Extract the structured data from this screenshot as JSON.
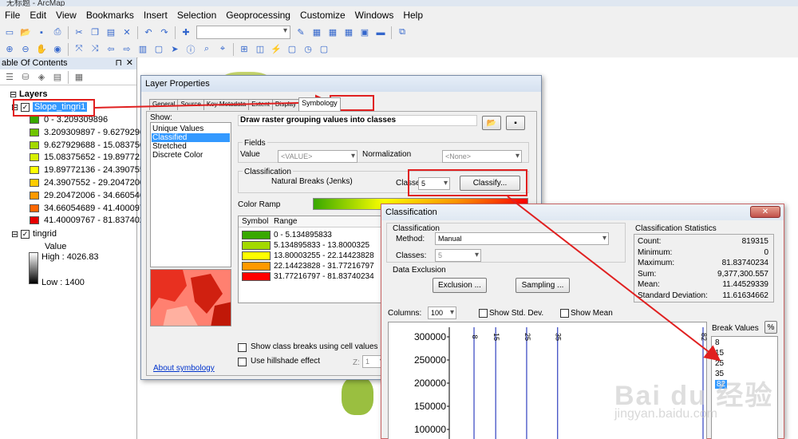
{
  "window": {
    "title": "无标题 - ArcMap"
  },
  "menu": [
    "File",
    "Edit",
    "View",
    "Bookmarks",
    "Insert",
    "Selection",
    "Geoprocessing",
    "Customize",
    "Windows",
    "Help"
  ],
  "toc": {
    "title": "able Of Contents",
    "layers_label": "Layers",
    "layer1": "Slope_tingri1",
    "classes": [
      {
        "label": "0 - 3.209309896",
        "color": "#38a800"
      },
      {
        "label": "3.209309897 - 9.62792968",
        "color": "#6fc400"
      },
      {
        "label": "9.627929688 - 15.0837565",
        "color": "#a3d900"
      },
      {
        "label": "15.08375652 - 19.8977213",
        "color": "#d6f000"
      },
      {
        "label": "19.89772136 - 24.3907552",
        "color": "#ffff00"
      },
      {
        "label": "24.3907552 - 29.2047200",
        "color": "#ffcc00"
      },
      {
        "label": "29.20472006 - 34.6605468",
        "color": "#ff9900"
      },
      {
        "label": "34.66054689 - 41.4000976",
        "color": "#ff6600"
      },
      {
        "label": "41.40009767 - 81.8374023",
        "color": "#e60000"
      }
    ],
    "layer2": "tingrid",
    "value_label": "Value",
    "high": "High : 4026.83",
    "low": "Low : 1400"
  },
  "layer_props": {
    "title": "Layer Properties",
    "tabs": [
      "General",
      "Source",
      "Key Metadata",
      "Extent",
      "Display",
      "Symbology"
    ],
    "show_label": "Show:",
    "show_items": [
      "Unique Values",
      "Classified",
      "Stretched",
      "Discrete Color"
    ],
    "heading": "Draw raster grouping values into classes",
    "fields_label": "Fields",
    "value_label": "Value",
    "value_field": "<VALUE>",
    "normalization_label": "Normalization",
    "normalization_field": "<None>",
    "classification_label": "Classification",
    "method": "Natural Breaks (Jenks)",
    "classes_label": "Classes",
    "classes_value": "5",
    "classify_button": "Classify...",
    "color_ramp_label": "Color Ramp",
    "symbol_header": "Symbol",
    "range_header": "Range",
    "rows": [
      {
        "range": "0 - 5.134895833",
        "color": "#38a800"
      },
      {
        "range": "5.134895833 - 13.8000325",
        "color": "#a3d900"
      },
      {
        "range": "13.80003255 - 22.14423828",
        "color": "#ffff00"
      },
      {
        "range": "22.14423828 - 31.77216797",
        "color": "#ff9900"
      },
      {
        "range": "31.77216797 - 81.83740234",
        "color": "#ff0000"
      }
    ],
    "show_breaks": "Show class breaks using cell values",
    "hillshade": "Use hillshade effect",
    "z_label": "Z:",
    "z_value": "1",
    "about": "About symbology"
  },
  "classification": {
    "title": "Classification",
    "group_label": "Classification",
    "method_label": "Method:",
    "method_value": "Manual",
    "classes_label": "Classes:",
    "classes_value": "5",
    "exclusion_label": "Data Exclusion",
    "exclusion_button": "Exclusion ...",
    "sampling_button": "Sampling ...",
    "stats_title": "Classification Statistics",
    "stats": [
      {
        "k": "Count:",
        "v": "819315"
      },
      {
        "k": "Minimum:",
        "v": "0"
      },
      {
        "k": "Maximum:",
        "v": "81.83740234"
      },
      {
        "k": "Sum:",
        "v": "9,377,300.557"
      },
      {
        "k": "Mean:",
        "v": "11.44529339"
      },
      {
        "k": "Standard Deviation:",
        "v": "11.61634662"
      }
    ],
    "columns_label": "Columns:",
    "columns_value": "100",
    "std_dev": "Show Std. Dev.",
    "show_mean": "Show Mean",
    "break_values_label": "Break Values",
    "percent_btn": "%",
    "break_values": [
      "8",
      "15",
      "25",
      "35",
      "82"
    ],
    "histogram": {
      "yticks": [
        "300000",
        "250000",
        "200000",
        "150000",
        "100000"
      ],
      "ytick_values": [
        300000,
        250000,
        200000,
        150000,
        100000
      ],
      "breaks": [
        "8",
        "15",
        "25",
        "35",
        "82"
      ],
      "break_values": [
        8,
        15,
        25,
        35,
        82
      ]
    }
  },
  "watermark": {
    "main": "Bai du 经验",
    "sub": "jingyan.baidu.com"
  }
}
